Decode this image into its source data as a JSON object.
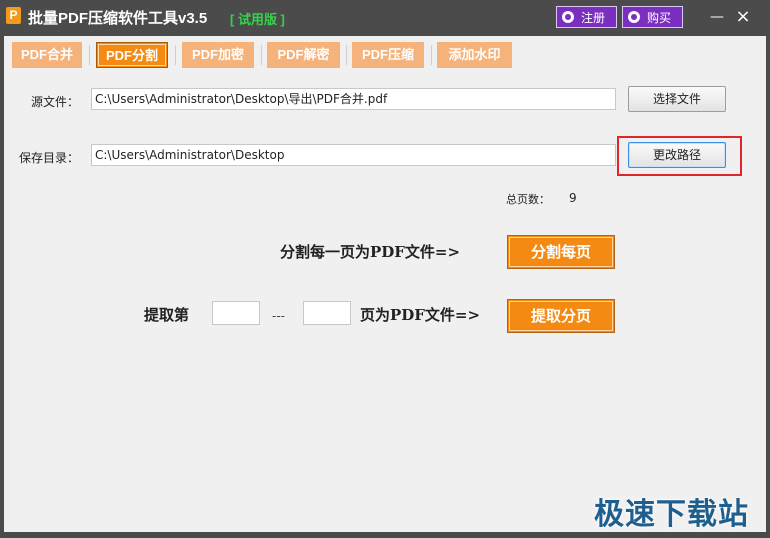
{
  "app": {
    "icon_letter": "P",
    "title": "批量PDF压缩软件工具v3.5",
    "trial_label": "[ 试用版 ]"
  },
  "titlebar": {
    "register_label": "注册",
    "buy_label": "购买",
    "minimize_glyph": "—",
    "close_glyph": "×"
  },
  "tabs": [
    {
      "label": "PDF合并",
      "active": false
    },
    {
      "label": "PDF分割",
      "active": true
    },
    {
      "label": "PDF加密",
      "active": false
    },
    {
      "label": "PDF解密",
      "active": false
    },
    {
      "label": "PDF压缩",
      "active": false
    },
    {
      "label": "添加水印",
      "active": false
    }
  ],
  "source": {
    "label": "源文件：",
    "value": "C:\\Users\\Administrator\\Desktop\\导出\\PDF合并.pdf",
    "button": "选择文件"
  },
  "save": {
    "label": "保存目录：",
    "value": "C:\\Users\\Administrator\\Desktop",
    "button": "更改路径"
  },
  "total_pages": {
    "label": "总页数：",
    "value": "9"
  },
  "split_each": {
    "label": "分割每一页为PDF文件=>",
    "button": "分割每页"
  },
  "extract": {
    "label_prefix": "提取第",
    "separator": "---",
    "label_suffix": "页为PDF文件=>",
    "button": "提取分页",
    "from_value": "",
    "to_value": ""
  },
  "watermark": "极速下载站",
  "colors": {
    "accent_orange": "#f48a12",
    "tab_inactive": "#f5b27a",
    "titlebar": "#4b4b4b",
    "trial_green": "#38d24a",
    "purple_button": "#7a2fc0",
    "highlight_red": "#e0252b"
  }
}
